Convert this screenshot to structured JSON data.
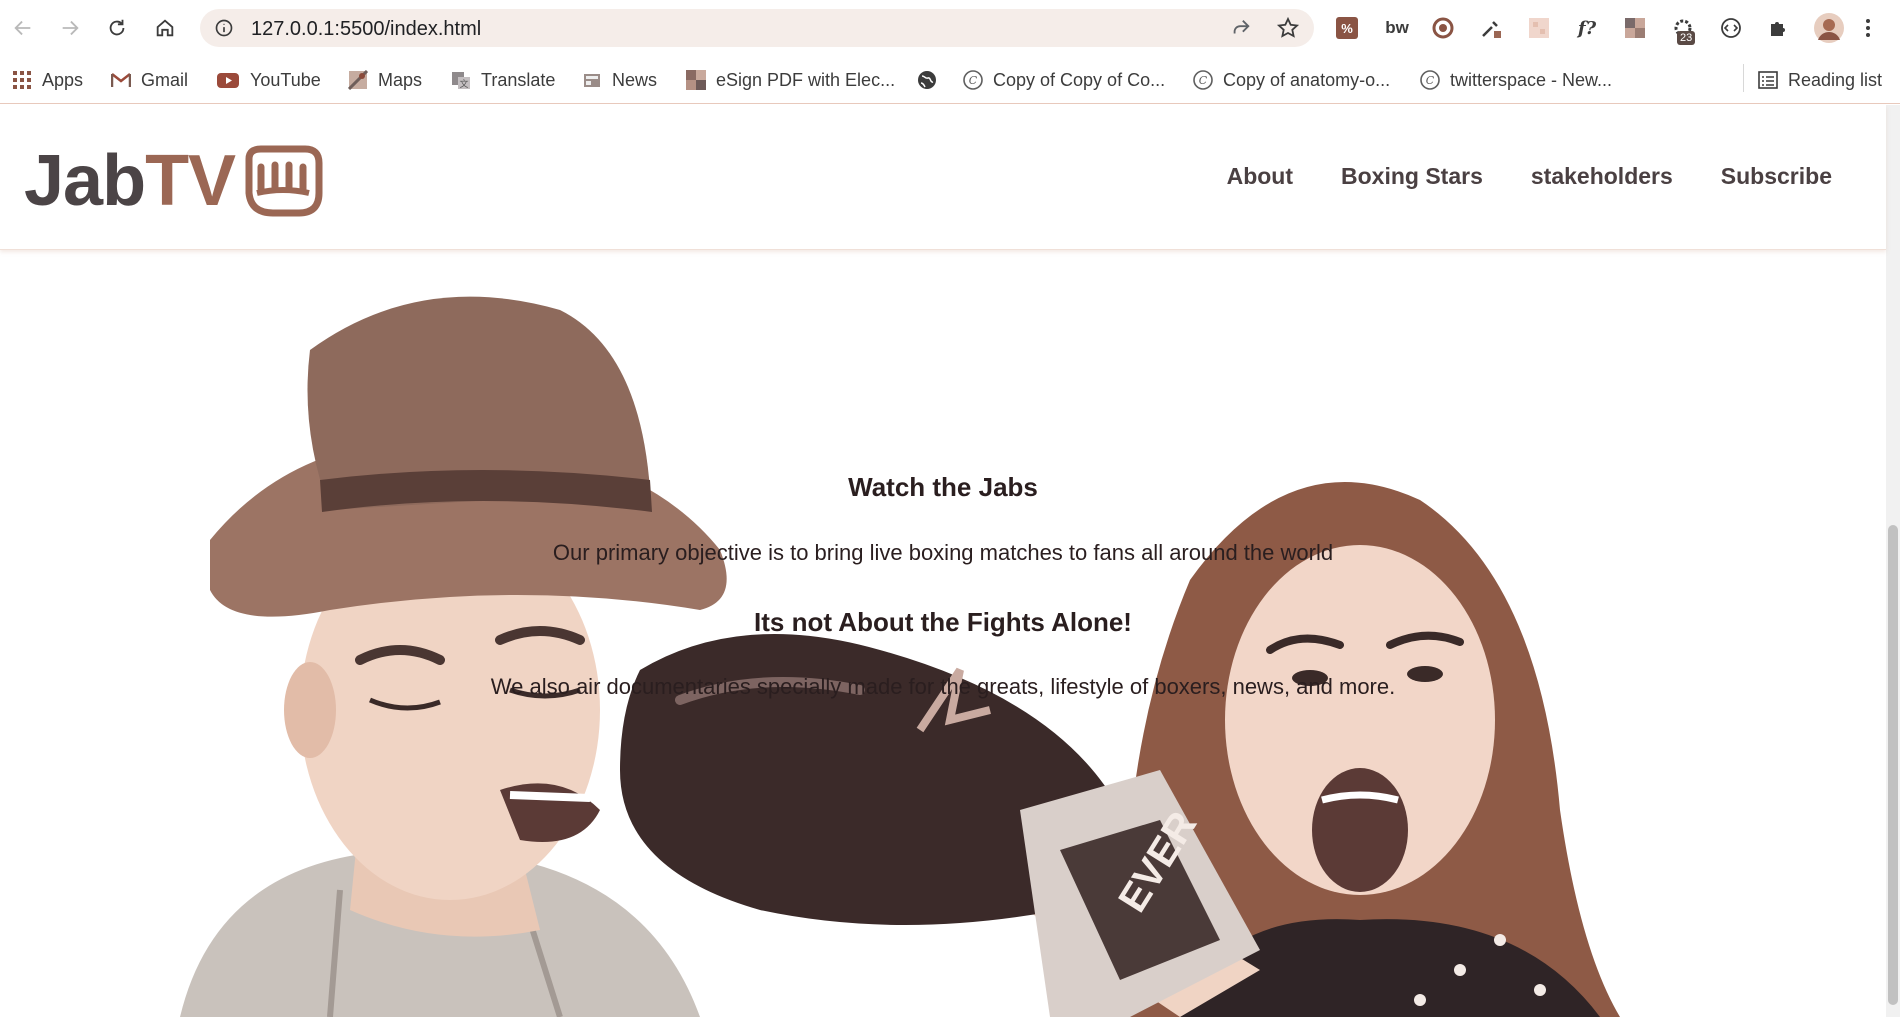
{
  "browser": {
    "url": "127.0.0.1:5500/index.html",
    "extension_badge": "23",
    "bookmarks": [
      {
        "label": "Apps",
        "icon": "apps-grid-icon"
      },
      {
        "label": "Gmail",
        "icon": "gmail-icon"
      },
      {
        "label": "YouTube",
        "icon": "youtube-icon"
      },
      {
        "label": "Maps",
        "icon": "maps-icon"
      },
      {
        "label": "Translate",
        "icon": "translate-icon"
      },
      {
        "label": "News",
        "icon": "news-icon"
      },
      {
        "label": "eSign PDF with Elec...",
        "icon": "esign-icon"
      },
      {
        "label": "",
        "icon": "globe-icon"
      },
      {
        "label": "Copy of Copy of Co...",
        "icon": "copy-icon"
      },
      {
        "label": "Copy of anatomy-o...",
        "icon": "copy-icon"
      },
      {
        "label": "twitterspace - New...",
        "icon": "copy-icon"
      }
    ],
    "reading_list": "Reading list"
  },
  "site": {
    "logo": {
      "part1": "Jab",
      "part2": "TV"
    },
    "nav": [
      "About",
      "Boxing Stars",
      "stakeholders",
      "Subscribe"
    ],
    "hero": {
      "title": "Watch the Jabs",
      "paragraph1": "Our primary objective is to bring live boxing matches to fans all around the world",
      "subtitle": "Its not About the Fights Alone!",
      "paragraph2": "We also air documentaries specially made for the greats, lifestyle of boxers, news, and more."
    }
  },
  "colors": {
    "brand_dark": "#4b4446",
    "brand_accent": "#9b6754",
    "omnibox_bg": "#f5ede9"
  }
}
